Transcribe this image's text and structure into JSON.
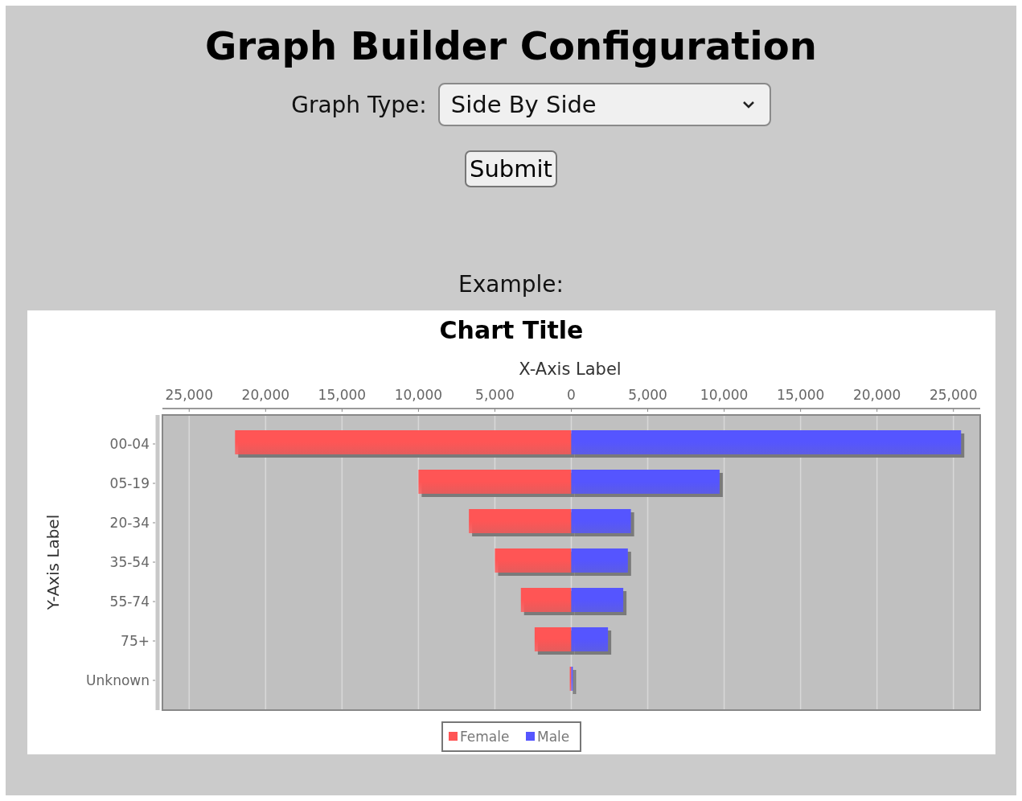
{
  "page": {
    "title": "Graph Builder Configuration"
  },
  "form": {
    "label": "Graph Type:",
    "value": "Side By Side",
    "submit": "Submit"
  },
  "example": {
    "label": "Example:",
    "chart_data": {
      "type": "bar",
      "orientation": "horizontal",
      "stacked": true,
      "grid": true,
      "legend": true,
      "title": "Chart Title",
      "xlabel": "X-Axis Label",
      "ylabel": "Y-Axis Label",
      "categories": [
        "00-04",
        "05-19",
        "20-34",
        "35-54",
        "55-74",
        "75+",
        "Unknown"
      ],
      "series": [
        {
          "name": "Female",
          "color": "#ff5555",
          "values": [
            -22000,
            -10000,
            -6700,
            -5000,
            -3300,
            -2400,
            -100
          ]
        },
        {
          "name": "Male",
          "color": "#5555ff",
          "values": [
            25500,
            9700,
            3900,
            3700,
            3400,
            2400,
            100
          ]
        }
      ],
      "xlim": [
        -26750,
        26750
      ],
      "xticks": [
        {
          "value": -25000,
          "label": "25,000"
        },
        {
          "value": -20000,
          "label": "20,000"
        },
        {
          "value": -15000,
          "label": "15,000"
        },
        {
          "value": -10000,
          "label": "10,000"
        },
        {
          "value": -5000,
          "label": "5,000"
        },
        {
          "value": 0,
          "label": "0"
        },
        {
          "value": 5000,
          "label": "5,000"
        },
        {
          "value": 10000,
          "label": "10,000"
        },
        {
          "value": 15000,
          "label": "15,000"
        },
        {
          "value": 20000,
          "label": "20,000"
        },
        {
          "value": 25000,
          "label": "25,000"
        }
      ]
    }
  }
}
